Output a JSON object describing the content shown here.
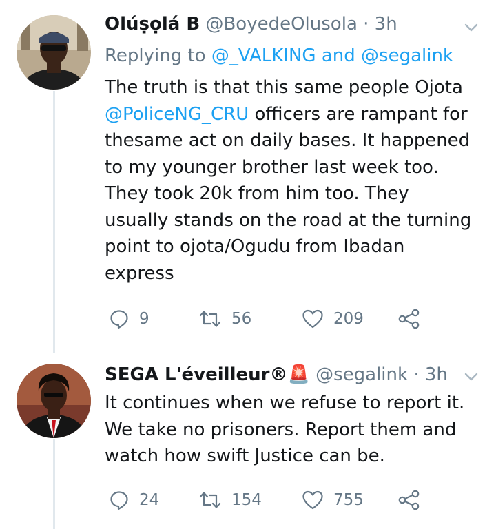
{
  "tweets": [
    {
      "name": "Olúṣọlá B",
      "handle": "@BoyedeOlusola",
      "separator": "·",
      "time": "3h",
      "replying_prefix": "Replying to",
      "reply_mention_1": "@_VALKING",
      "reply_and": "and",
      "reply_mention_2": "@segalink",
      "text_lines": [
        "The truth is that this same people Ojota",
        "officers are rampant for",
        "thesame act on daily bases. It happened",
        "to my younger brother last week too.",
        "They took 20k from him too. They",
        "usually stands on the road at the turning",
        "point to ojota/Ogudu from Ibadan",
        "express"
      ],
      "inline_mention": "@PoliceNG_CRU",
      "replies": "9",
      "retweets": "56",
      "likes": "209"
    },
    {
      "name": "SEGA L'éveilleur®",
      "name_emoji": "🚨",
      "handle": "@segalink",
      "separator": "·",
      "time": "3h",
      "text_lines": [
        "It continues when we refuse to report it.",
        "We take no prisoners. Report them and",
        "watch how swift Justice can be."
      ],
      "replies": "24",
      "retweets": "154",
      "likes": "755"
    }
  ],
  "icons": {
    "reply": "reply-icon",
    "retweet": "retweet-icon",
    "like": "heart-icon",
    "share": "share-icon",
    "more": "chevron-down-icon"
  },
  "colors": {
    "text": "#14171a",
    "secondary": "#657786",
    "link": "#1da1f2",
    "thread_line": "#e1e8ed"
  }
}
